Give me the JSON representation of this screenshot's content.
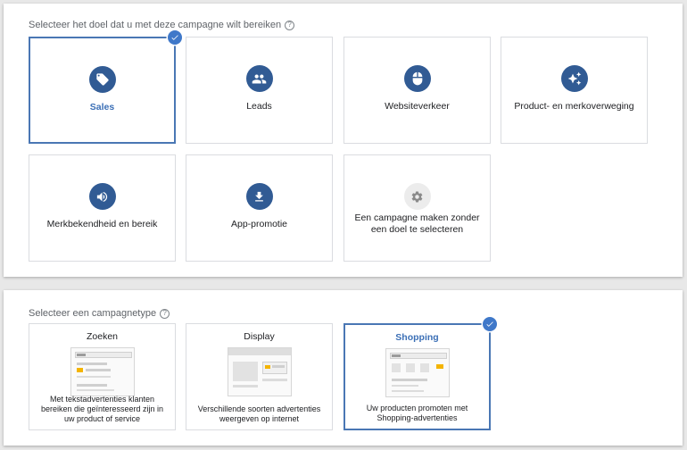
{
  "goal_section": {
    "heading": "Selecteer het doel dat u met deze campagne wilt bereiken",
    "help_glyph": "?",
    "goals": [
      {
        "label": "Sales",
        "icon": "tag-icon",
        "selected": true
      },
      {
        "label": "Leads",
        "icon": "people-icon",
        "selected": false
      },
      {
        "label": "Websiteverkeer",
        "icon": "mouse-icon",
        "selected": false
      },
      {
        "label": "Product- en merkoverweging",
        "icon": "sparkle-icon",
        "selected": false
      },
      {
        "label": "Merkbekendheid en bereik",
        "icon": "speaker-icon",
        "selected": false
      },
      {
        "label": "App-promotie",
        "icon": "download-icon",
        "selected": false
      },
      {
        "label": "Een campagne maken zonder een doel te selecteren",
        "icon": "gear-icon",
        "selected": false
      }
    ]
  },
  "type_section": {
    "heading": "Selecteer een campagnetype",
    "help_glyph": "?",
    "types": [
      {
        "title": "Zoeken",
        "description": "Met tekstadvertenties klanten bereiken die geïnteresseerd zijn in uw product of service",
        "selected": false
      },
      {
        "title": "Display",
        "description": "Verschillende soorten advertenties weergeven op internet",
        "selected": false
      },
      {
        "title": "Shopping",
        "description": "Uw producten promoten met Shopping-advertenties",
        "selected": true
      }
    ]
  },
  "colors": {
    "accent": "#3f78c9",
    "icon_circle": "#315b94",
    "selected_border": "#4a77b4",
    "ad_highlight": "#f4b400"
  }
}
